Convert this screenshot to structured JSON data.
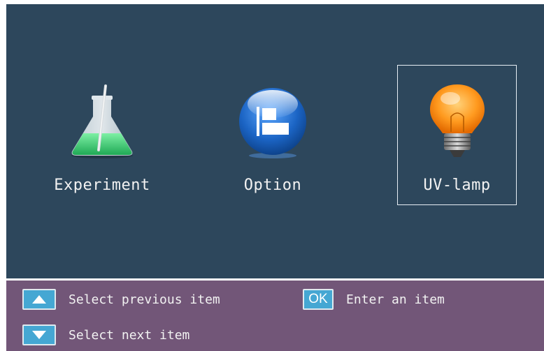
{
  "menu": {
    "items": [
      {
        "label": "Experiment",
        "icon": "flask-icon"
      },
      {
        "label": "Option",
        "icon": "option-icon"
      },
      {
        "label": "UV-lamp",
        "icon": "lightbulb-icon"
      }
    ],
    "selected_index": 2
  },
  "help": {
    "up": {
      "key_icon": "up-arrow-icon",
      "text": "Select previous item"
    },
    "ok": {
      "key_label": "OK",
      "text": "Enter an item"
    },
    "down": {
      "key_icon": "down-arrow-icon",
      "text": "Select next item"
    }
  },
  "colors": {
    "screen_bg": "#2d475c",
    "help_bar_bg": "#725678",
    "key_bg": "#45a7d3",
    "selection_border": "#e6eef4"
  }
}
